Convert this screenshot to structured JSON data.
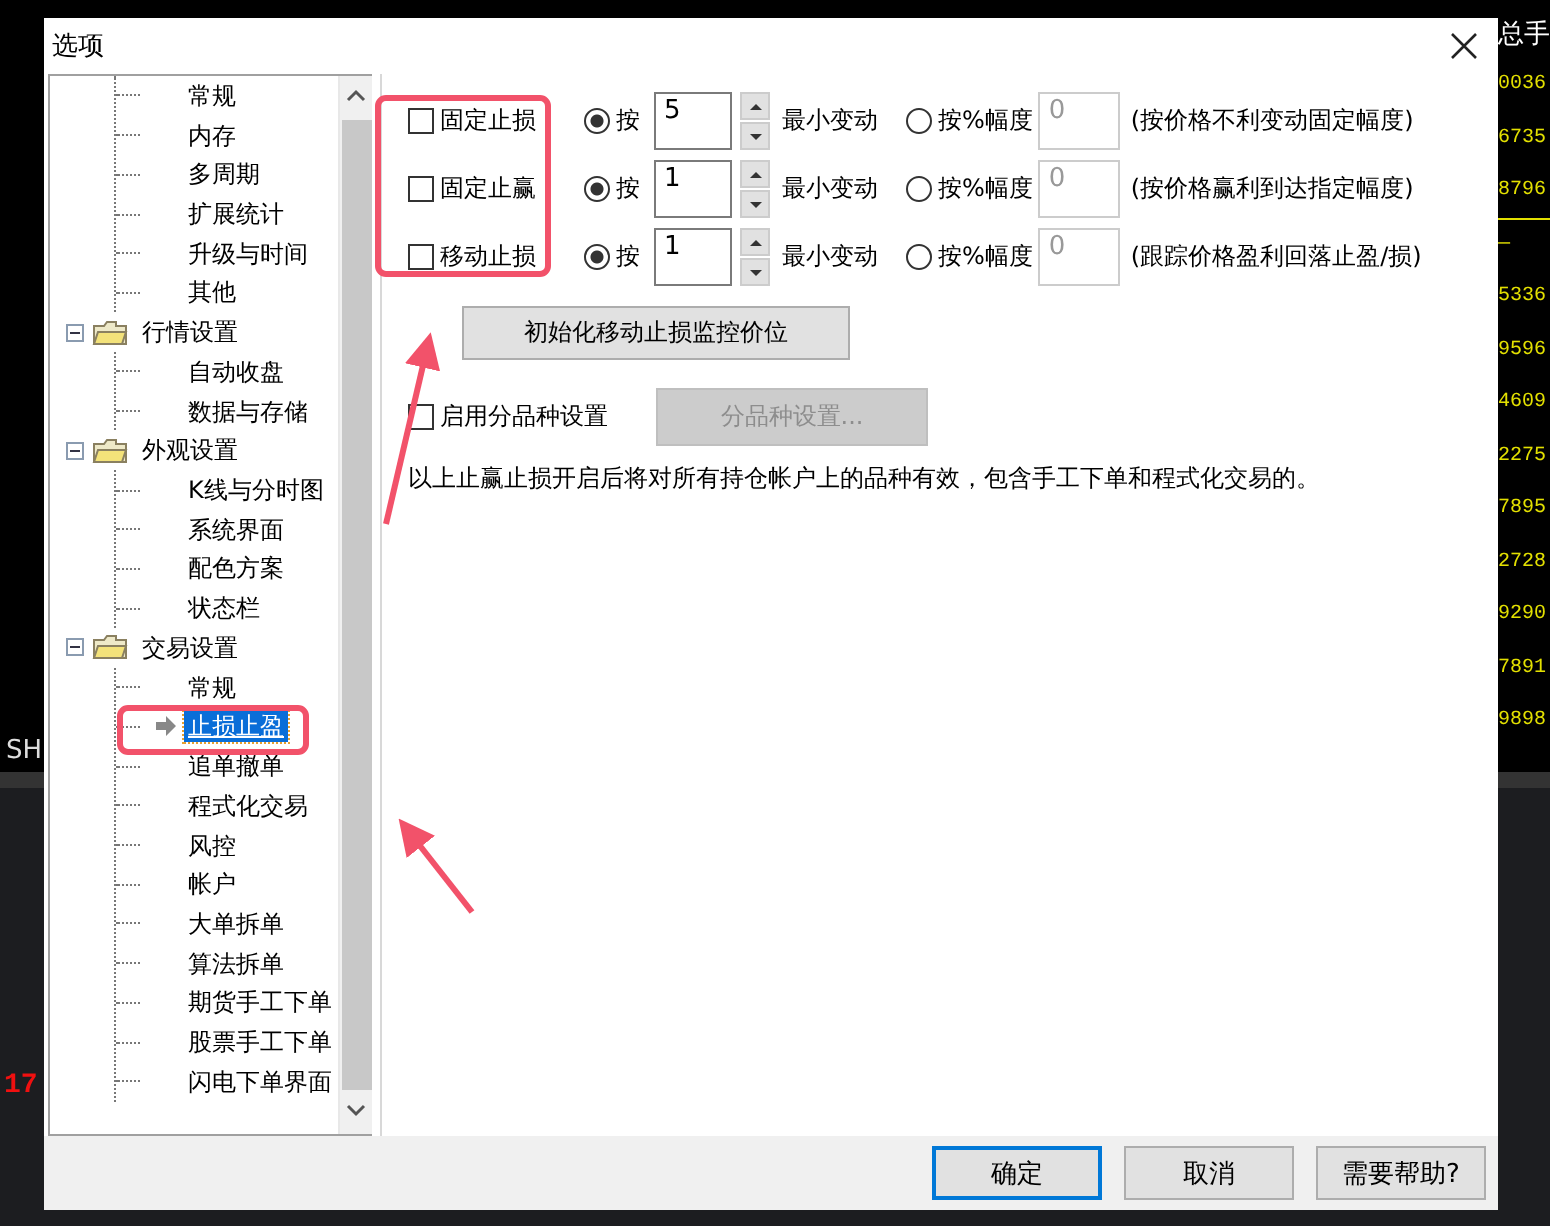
{
  "background": {
    "left_labels": [
      {
        "text": "SH",
        "kind": "plain"
      },
      {
        "text": "17",
        "kind": "price"
      }
    ],
    "column_header": "总手",
    "column_values": [
      "0036",
      "6735",
      "8796",
      "—",
      "5336",
      "9596",
      "4609",
      "2275",
      "7895",
      "2728",
      "9290",
      "7891",
      "9898"
    ]
  },
  "dialog": {
    "title": "选项"
  },
  "tree": [
    {
      "expanded": true,
      "children": [
        {
          "label": "常规",
          "selected": false
        },
        {
          "label": "内存",
          "selected": false
        },
        {
          "label": "多周期",
          "selected": false
        },
        {
          "label": "扩展统计",
          "selected": false
        },
        {
          "label": "升级与时间",
          "selected": false
        },
        {
          "label": "其他",
          "selected": false
        }
      ]
    },
    {
      "label": "行情设置",
      "expanded": true,
      "children": [
        {
          "label": "自动收盘",
          "selected": false
        },
        {
          "label": "数据与存储",
          "selected": false
        }
      ]
    },
    {
      "label": "外观设置",
      "expanded": true,
      "children": [
        {
          "label": "K线与分时图",
          "selected": false
        },
        {
          "label": "系统界面",
          "selected": false
        },
        {
          "label": "配色方案",
          "selected": false
        },
        {
          "label": "状态栏",
          "selected": false
        }
      ]
    },
    {
      "label": "交易设置",
      "expanded": true,
      "children": [
        {
          "label": "常规",
          "selected": false
        },
        {
          "label": "止损止盈",
          "selected": true
        },
        {
          "label": "追单撤单",
          "selected": false
        },
        {
          "label": "程式化交易",
          "selected": false
        },
        {
          "label": "风控",
          "selected": false
        },
        {
          "label": "帐户",
          "selected": false
        },
        {
          "label": "大单拆单",
          "selected": false
        },
        {
          "label": "算法拆单",
          "selected": false
        },
        {
          "label": "期货手工下单",
          "selected": false
        },
        {
          "label": "股票手工下单",
          "selected": false
        },
        {
          "label": "闪电下单界面",
          "selected": false
        }
      ]
    }
  ],
  "stop_rows": [
    {
      "label": "固定止损",
      "checked": false,
      "options": [
        {
          "label": "按",
          "selected": true
        },
        {
          "label": "按%幅度",
          "selected": false
        }
      ],
      "ticks": "5",
      "unit": "最小变动",
      "percent": "0",
      "percent_disabled": true,
      "note": "(按价格不利变动固定幅度)"
    },
    {
      "label": "固定止赢",
      "checked": false,
      "options": [
        {
          "label": "按",
          "selected": true
        },
        {
          "label": "按%幅度",
          "selected": false
        }
      ],
      "ticks": "1",
      "unit": "最小变动",
      "percent": "0",
      "percent_disabled": true,
      "note": "(按价格赢利到达指定幅度)"
    },
    {
      "label": "移动止损",
      "checked": false,
      "options": [
        {
          "label": "按",
          "selected": true
        },
        {
          "label": "按%幅度",
          "selected": false
        }
      ],
      "ticks": "1",
      "unit": "最小变动",
      "percent": "0",
      "percent_disabled": true,
      "note": "(跟踪价格盈利回落止盈/损)"
    }
  ],
  "init_button": "初始化移动止损监控价位",
  "per_symbol": {
    "label": "启用分品种设置",
    "checked": false,
    "button": "分品种设置...",
    "button_disabled": true
  },
  "note": "以上止赢止损开启后将对所有持仓帐户上的品种有效，包含手工下单和程式化交易的。",
  "buttons": [
    {
      "label": "确定",
      "default": true
    },
    {
      "label": "取消",
      "default": false
    },
    {
      "label": "需要帮助?",
      "default": false
    }
  ]
}
